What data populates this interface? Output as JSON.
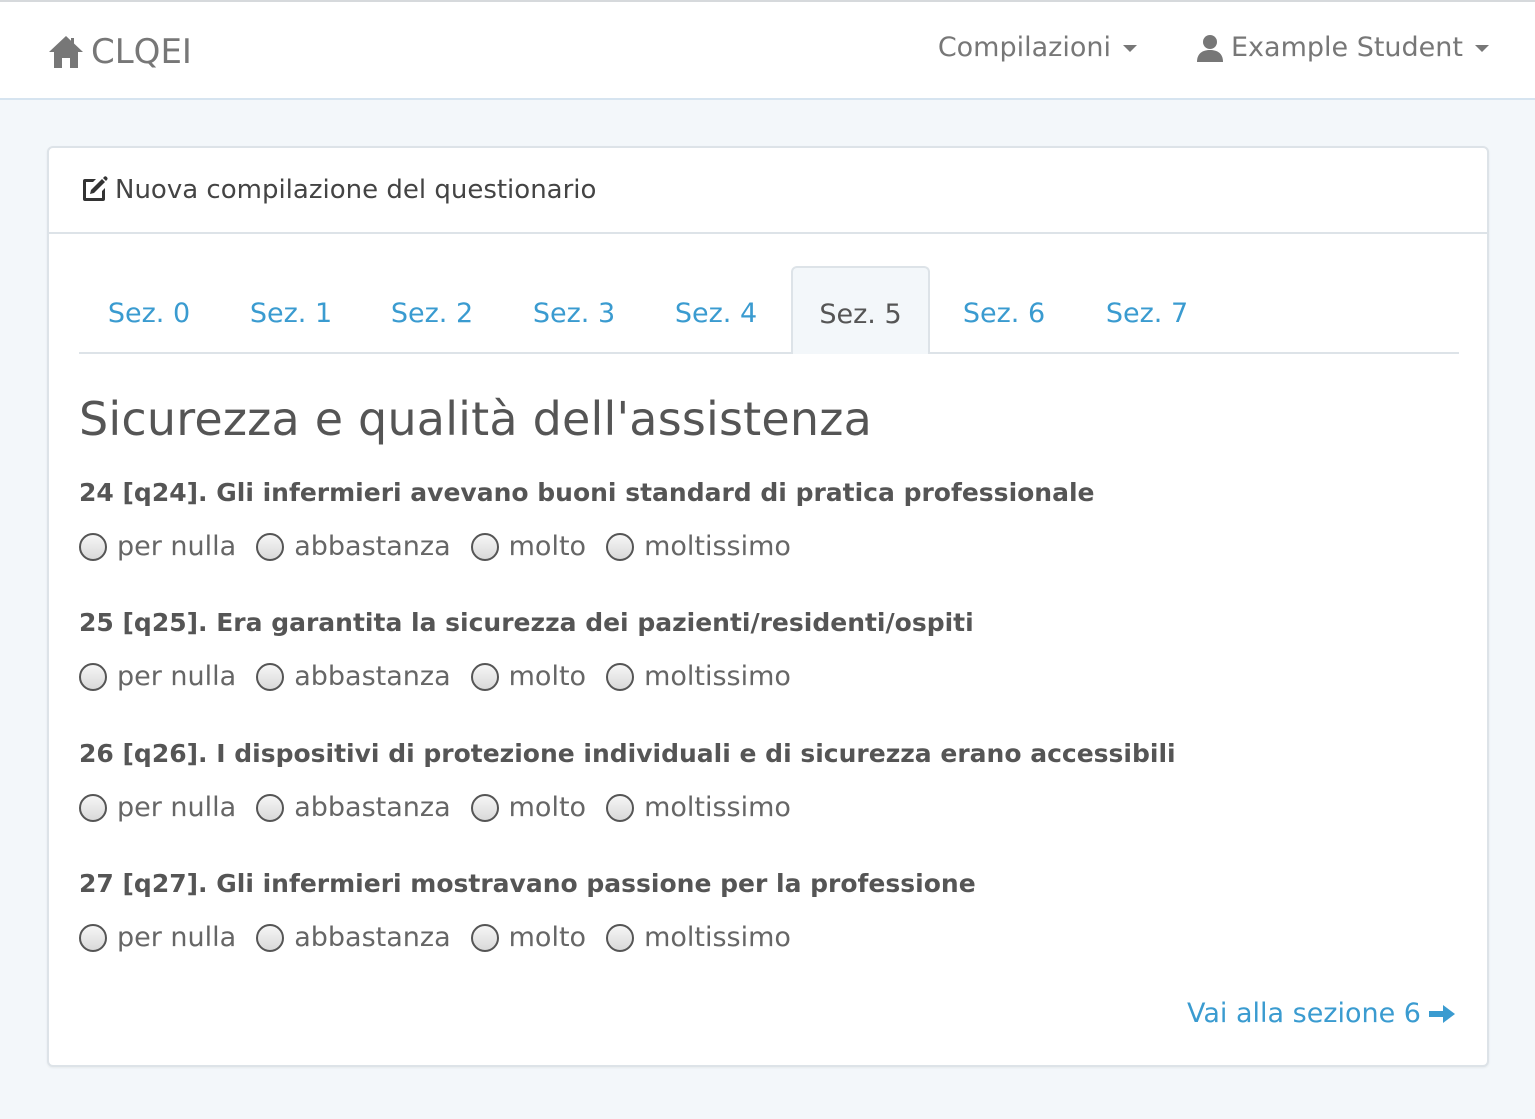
{
  "navbar": {
    "brand": "CLQEI",
    "menu_compilazioni": "Compilazioni",
    "user_name": "Example Student"
  },
  "panel": {
    "heading": "Nuova compilazione del questionario"
  },
  "tabs": [
    {
      "label": "Sez. 0",
      "active": false
    },
    {
      "label": "Sez. 1",
      "active": false
    },
    {
      "label": "Sez. 2",
      "active": false
    },
    {
      "label": "Sez. 3",
      "active": false
    },
    {
      "label": "Sez. 4",
      "active": false
    },
    {
      "label": "Sez. 5",
      "active": true
    },
    {
      "label": "Sez. 6",
      "active": false
    },
    {
      "label": "Sez. 7",
      "active": false
    }
  ],
  "section_title": "Sicurezza e qualità dell'assistenza",
  "options": [
    "per nulla",
    "abbastanza",
    "molto",
    "moltissimo"
  ],
  "questions": [
    {
      "label": "24 [q24]. Gli infermieri avevano buoni standard di pratica professionale"
    },
    {
      "label": "25 [q25]. Era garantita la sicurezza dei pazienti/residenti/ospiti"
    },
    {
      "label": "26 [q26]. I dispositivi di protezione individuali e di sicurezza erano accessibili"
    },
    {
      "label": "27 [q27]. Gli infermieri mostravano passione per la professione"
    }
  ],
  "next_link": "Vai alla sezione 6",
  "colors": {
    "link": "#3a9bd0",
    "background": "#f3f7fa",
    "text": "#555555"
  }
}
